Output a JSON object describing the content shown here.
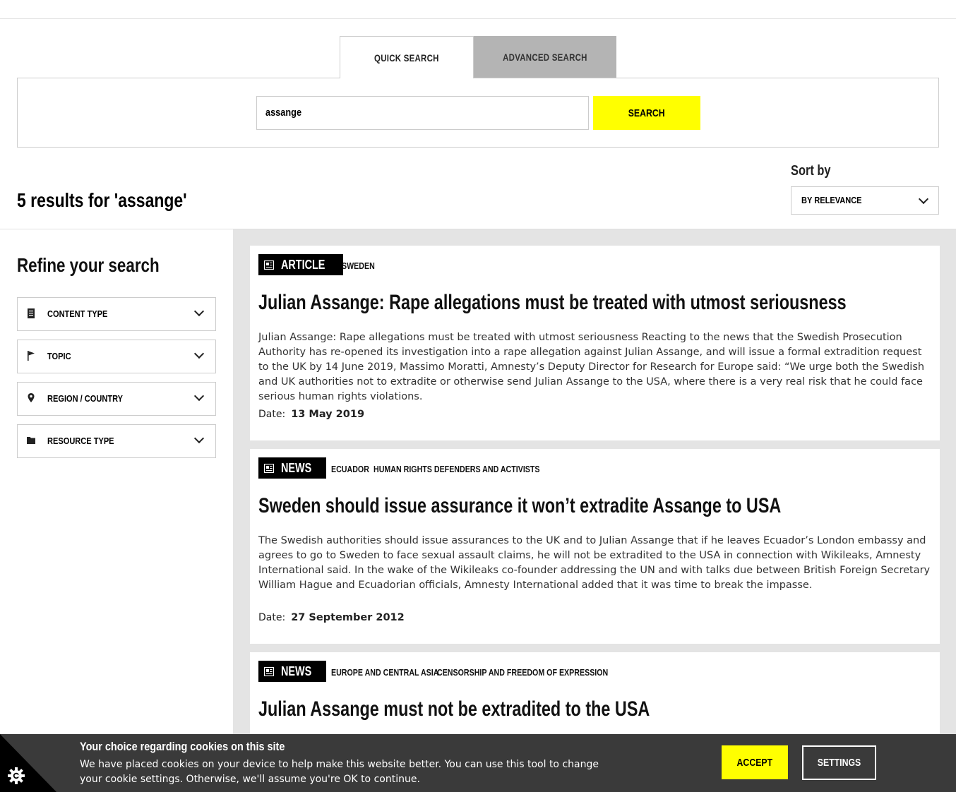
{
  "tabs": {
    "quick": "QUICK SEARCH",
    "advanced": "ADVANCED SEARCH"
  },
  "search": {
    "value": "assange",
    "button": "SEARCH"
  },
  "results": {
    "count_text": "5 results for 'assange'"
  },
  "sort": {
    "label": "Sort by",
    "selected": "BY RELEVANCE"
  },
  "sidebar": {
    "title": "Refine your search",
    "filters": [
      {
        "label": "CONTENT TYPE",
        "icon": "document-icon"
      },
      {
        "label": "TOPIC",
        "icon": "flag-icon"
      },
      {
        "label": "REGION / COUNTRY",
        "icon": "location-pin-icon"
      },
      {
        "label": "RESOURCE TYPE",
        "icon": "folder-icon"
      }
    ]
  },
  "cards": [
    {
      "type": "ARTICLE",
      "tags": [
        "SWEDEN"
      ],
      "title": "Julian Assange: Rape allegations must be treated with utmost seriousness",
      "body": "Julian Assange: Rape allegations must be treated with utmost seriousness Reacting to the news that the Swedish Prosecution Authority has re-opened its investigation into a rape allegation against Julian Assange, and will issue a formal extradition request to the UK by 14 June 2019, Massimo Moratti, Amnesty’s Deputy Director for Research for Europe said:      “We urge both the Swedish and UK authorities not to extradite or otherwise send Julian Assange to the USA, where there is a very real risk that he could face serious human rights violations.",
      "date_label": "Date:",
      "date": "13 May 2019"
    },
    {
      "type": "NEWS",
      "tags": [
        "ECUADOR",
        "HUMAN RIGHTS DEFENDERS AND ACTIVISTS"
      ],
      "title": "Sweden should issue assurance it won’t extradite Assange to USA",
      "body": "The Swedish authorities should issue assurances to the UK and to Julian Assange that if he leaves Ecuador’s London embassy and agrees to go to Sweden to face sexual assault claims, he will not be extradited to the USA in connection with Wikileaks, Amnesty International said. In the wake of the Wikileaks co-founder addressing the UN and with talks due between British Foreign Secretary William Hague and Ecuadorian officials, Amnesty International added that it was time to break the impasse.",
      "date_label": "Date:",
      "date": "27 September 2012"
    },
    {
      "type": "NEWS",
      "tags": [
        "EUROPE AND CENTRAL ASIA",
        "CENSORSHIP AND FREEDOM OF EXPRESSION"
      ],
      "title": "Julian Assange must not be extradited to the USA"
    }
  ],
  "cookie": {
    "title": "Your choice regarding cookies on this site",
    "text": "We have placed cookies on your device to help make this website better. You can use this tool to change your cookie settings. Otherwise, we'll assume you're OK to continue.",
    "accept": "ACCEPT",
    "settings": "SETTINGS"
  },
  "colors": {
    "accent_yellow": "#ffff00",
    "tab_inactive": "#b4b4b4",
    "results_bg": "#e4e4e4",
    "cookie_bg": "#3a3a3a"
  }
}
